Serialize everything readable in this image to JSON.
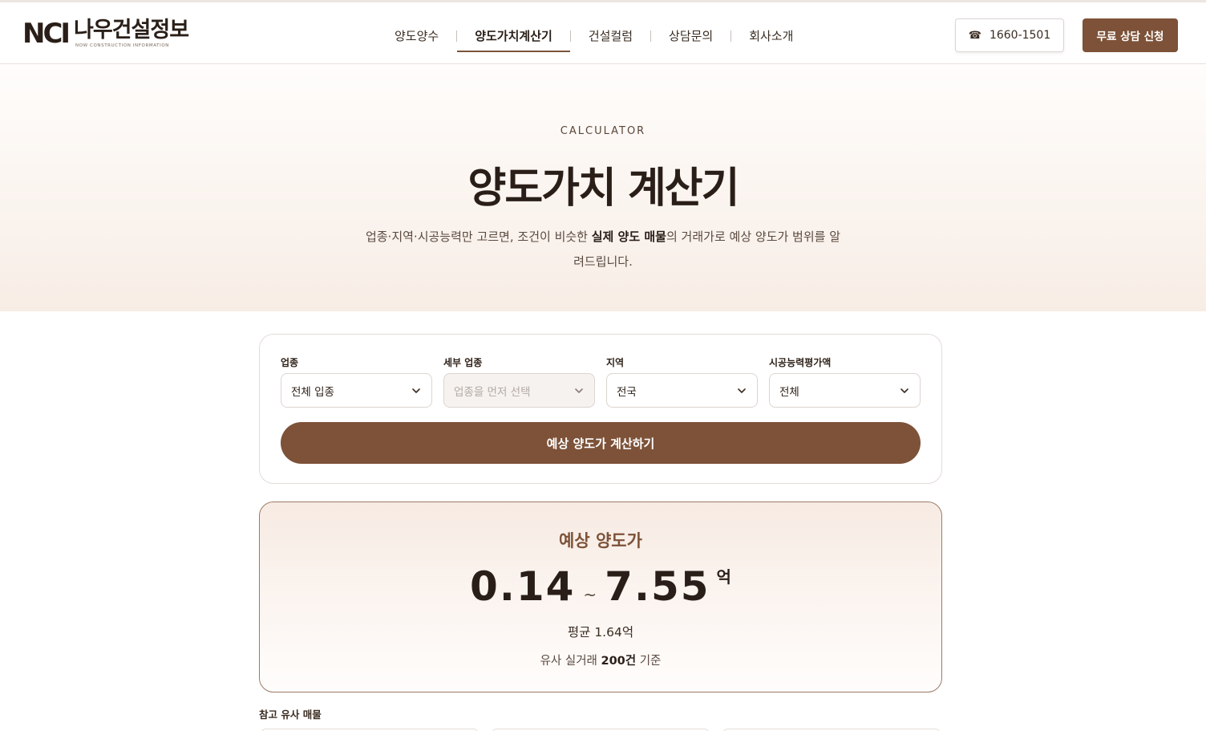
{
  "header": {
    "logo_mark": "NCI",
    "logo_name": "나우건설정보",
    "logo_tagline": "NOW CONSTRUCTION INFORMATION",
    "nav": [
      {
        "label": "양도양수"
      },
      {
        "label": "양도가치계산기",
        "active": true
      },
      {
        "label": "건설컬럼"
      },
      {
        "label": "상담문의"
      },
      {
        "label": "회사소개"
      }
    ],
    "phone_icon": "phone-icon",
    "phone": "1660-1501",
    "cta_label": "무료 상담 신청"
  },
  "hero": {
    "eyebrow": "CALCULATOR",
    "title": "양도가치 계산기",
    "desc_pre": "업종·지역·시공능력만 고르면, 조건이 비슷한 ",
    "desc_bold": "실제 양도 매물",
    "desc_post": "의 거래가로 예상 양도가 범위를 알려드립니다."
  },
  "filters": {
    "fields": [
      {
        "label": "업종",
        "value": "전체 입종",
        "disabled": false
      },
      {
        "label": "세부 업종",
        "value": "업종을 먼저 선택",
        "disabled": true
      },
      {
        "label": "지역",
        "value": "전국",
        "disabled": false
      },
      {
        "label": "시공능력평가액",
        "value": "전체",
        "disabled": false
      }
    ],
    "calc_label": "예상 양도가 계산하기"
  },
  "result": {
    "title": "예상 양도가",
    "min": "0.14",
    "sep": "~",
    "max": "7.55",
    "unit": "억",
    "avg": "평균 1.64억",
    "count_pre": "유사 실거래 ",
    "count_bold": "200건",
    "count_post": " 기준"
  },
  "similar": {
    "label": "참고 유사 매물"
  },
  "colors": {
    "accent": "#7d5238",
    "text_dark": "#2a1f18",
    "hero_bg_end": "#f7ede5"
  }
}
